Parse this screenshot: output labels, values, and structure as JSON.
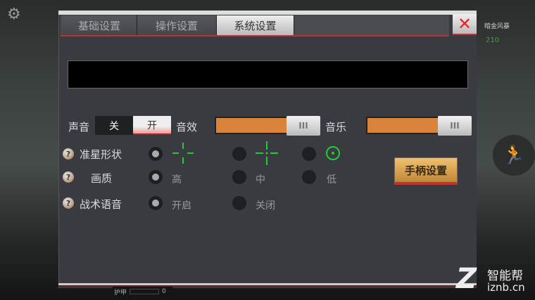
{
  "tabs": [
    {
      "label": "基础设置"
    },
    {
      "label": "操作设置"
    },
    {
      "label": "系统设置",
      "active": true
    }
  ],
  "close_label": "✕",
  "sound": {
    "label": "声音",
    "off": "关",
    "on": "开",
    "selected": "开"
  },
  "sfx": {
    "label": "音效",
    "value_percent": 70
  },
  "music": {
    "label": "音乐",
    "value_percent": 70
  },
  "crosshair": {
    "label": "准星形状",
    "selected": 0
  },
  "quality": {
    "label": "画质",
    "options": [
      "高",
      "中",
      "低"
    ],
    "selected": "高"
  },
  "voice": {
    "label": "战术语音",
    "options": [
      "开启",
      "关闭"
    ],
    "selected": "开启"
  },
  "gamepad_label": "手柄设置",
  "help_icon": "?",
  "knob_label": "III",
  "hud": {
    "weapon": "暗金风暴",
    "ammo": "210",
    "armor_label": "护甲",
    "armor_value": "0"
  },
  "watermark": {
    "name": "智能帮",
    "url": "iznb.cn"
  }
}
